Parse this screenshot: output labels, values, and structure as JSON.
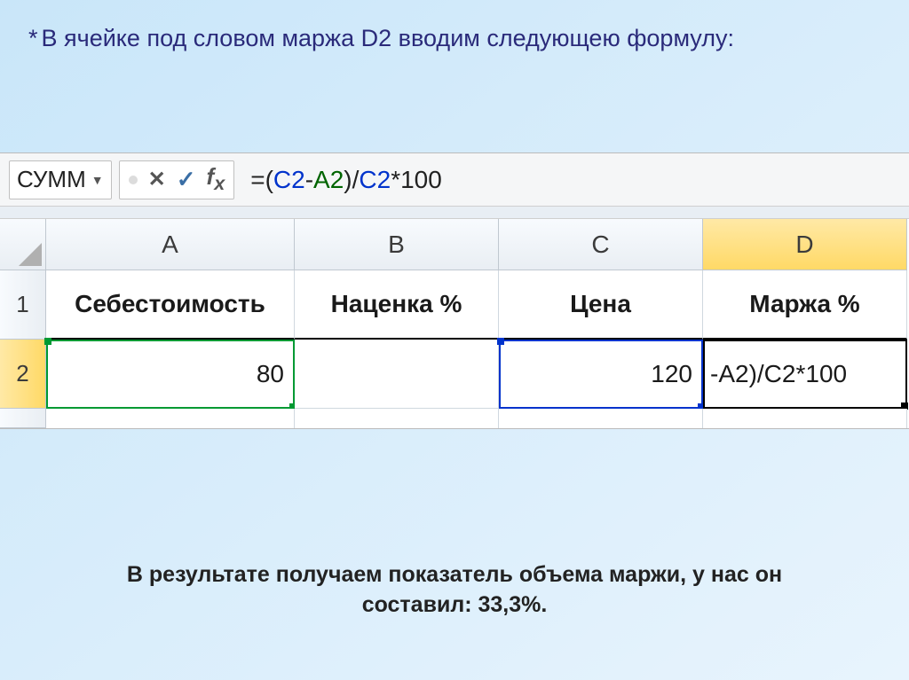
{
  "title_text": "В ячейке под словом маржа D2 вводим следующею формулу:",
  "namebox_value": "СУММ",
  "formula": {
    "eq": "=",
    "lp": "(",
    "ref1": "C2",
    "minus": "-",
    "ref2": "A2",
    "rp": ")",
    "div": "/",
    "ref3": "C2",
    "mul": "*",
    "hundred": "100"
  },
  "columns": {
    "a": "A",
    "b": "B",
    "c": "C",
    "d": "D"
  },
  "rows": {
    "r1": "1",
    "r2": "2",
    "r3": ""
  },
  "headers_row": {
    "a": "Себестоимость",
    "b": "Наценка %",
    "c": "Цена",
    "d": "Маржа %"
  },
  "data_row": {
    "a": "80",
    "b": "",
    "c": "120",
    "d": "-A2)/C2*100"
  },
  "caption_text": "В результате получаем показатель объема маржи, у нас он составил: 33,3%."
}
